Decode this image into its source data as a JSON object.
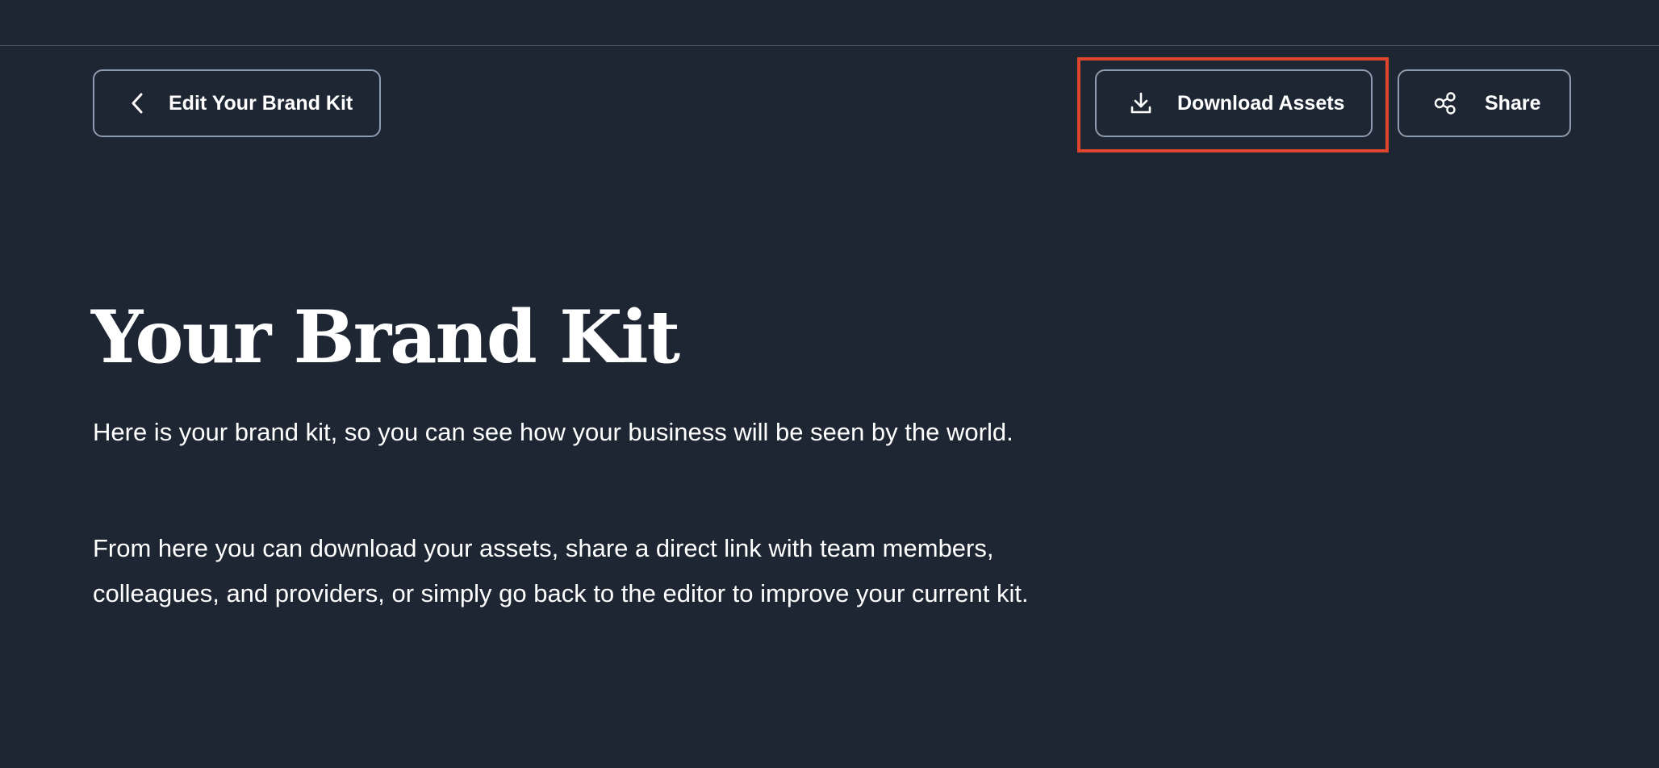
{
  "header": {
    "edit_label": "Edit Your Brand Kit",
    "download_label": "Download Assets",
    "share_label": "Share"
  },
  "icons": {
    "edit": "chevron-left-icon",
    "download": "download-icon",
    "share": "share-icon"
  },
  "main": {
    "title": "Your Brand Kit",
    "paragraph_1": "Here is your brand kit, so you can see how your business will be seen by the world.",
    "paragraph_2": "From here you can download your assets, share a direct link with team members, colleagues, and providers, or simply go back to the editor to improve your current kit."
  },
  "colors": {
    "background": "#1f2633",
    "button_border": "#8e9aaf",
    "highlight": "#e0462e",
    "text": "#ffffff"
  }
}
